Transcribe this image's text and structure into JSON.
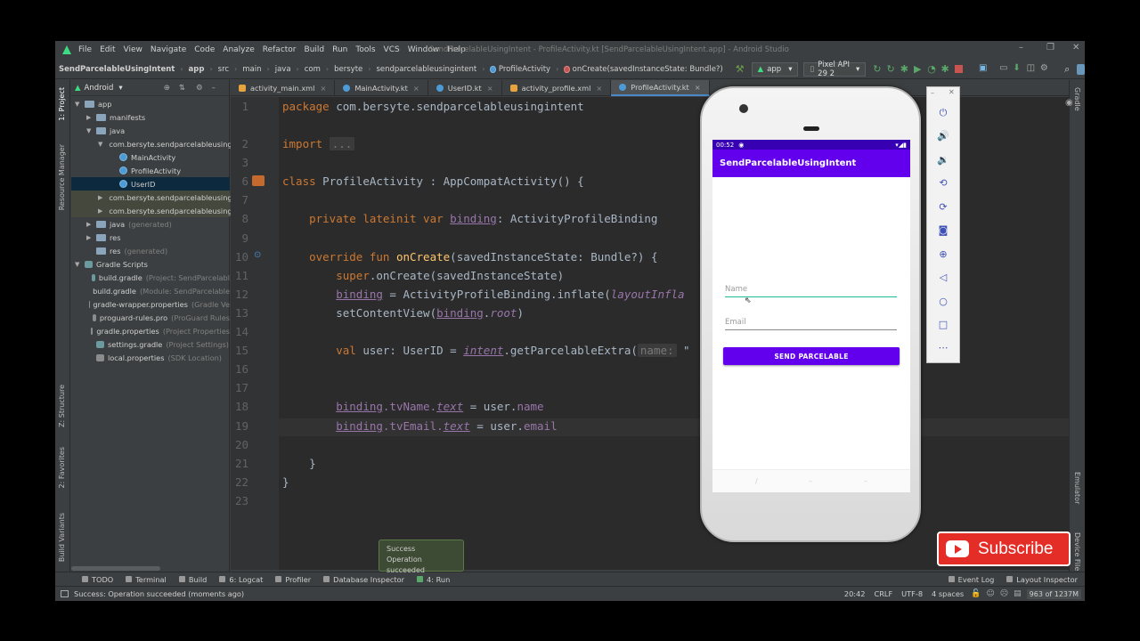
{
  "window": {
    "title": "SendParcelableUsingIntent - ProfileActivity.kt [SendParcelableUsingIntent.app] - Android Studio",
    "menu": [
      "File",
      "Edit",
      "View",
      "Navigate",
      "Code",
      "Analyze",
      "Refactor",
      "Build",
      "Run",
      "Tools",
      "VCS",
      "Window",
      "Help"
    ]
  },
  "breadcrumb": [
    "SendParcelableUsingIntent",
    "app",
    "src",
    "main",
    "java",
    "com",
    "bersyte",
    "sendparcelableusingintent",
    "ProfileActivity",
    "onCreate(savedInstanceState: Bundle?)"
  ],
  "toolbar": {
    "run_config": "app",
    "device": "Pixel API 29 2"
  },
  "project_panel": {
    "view_mode": "Android",
    "items": [
      {
        "label": "app",
        "depth": 0,
        "expanded": true,
        "icon": "folder-icon"
      },
      {
        "label": "manifests",
        "depth": 1,
        "expanded": false,
        "icon": "folder-icon"
      },
      {
        "label": "java",
        "depth": 1,
        "expanded": true,
        "icon": "folder-icon"
      },
      {
        "label": "com.bersyte.sendparcelableusing",
        "depth": 2,
        "expanded": true,
        "icon": "package-icon"
      },
      {
        "label": "MainActivity",
        "depth": 3,
        "icon": "kotlin-icon"
      },
      {
        "label": "ProfileActivity",
        "depth": 3,
        "icon": "kotlin-icon"
      },
      {
        "label": "UserID",
        "depth": 3,
        "icon": "kotlin-icon",
        "selected": true
      },
      {
        "label": "com.bersyte.sendparcelableusing",
        "depth": 2,
        "expanded": false,
        "icon": "package-icon"
      },
      {
        "label": "com.bersyte.sendparcelableusing",
        "depth": 2,
        "expanded": false,
        "icon": "package-icon"
      },
      {
        "label": "java",
        "hint": "(generated)",
        "depth": 1,
        "expanded": false,
        "icon": "folder-icon"
      },
      {
        "label": "res",
        "depth": 1,
        "expanded": false,
        "icon": "folder-icon"
      },
      {
        "label": "res",
        "hint": "(generated)",
        "depth": 1,
        "icon": "folder-icon"
      },
      {
        "label": "Gradle Scripts",
        "depth": 0,
        "expanded": true,
        "icon": "gradle-icon"
      },
      {
        "label": "build.gradle",
        "hint": "(Project: SendParcelabl",
        "depth": 1,
        "icon": "gradle-icon"
      },
      {
        "label": "build.gradle",
        "hint": "(Module: SendParcelable",
        "depth": 1,
        "icon": "gradle-icon"
      },
      {
        "label": "gradle-wrapper.properties",
        "hint": "(Gradle Ve",
        "depth": 1,
        "icon": "properties-icon"
      },
      {
        "label": "proguard-rules.pro",
        "hint": "(ProGuard Rules",
        "depth": 1,
        "icon": "properties-icon"
      },
      {
        "label": "gradle.properties",
        "hint": "(Project Properties",
        "depth": 1,
        "icon": "properties-icon"
      },
      {
        "label": "settings.gradle",
        "hint": "(Project Settings)",
        "depth": 1,
        "icon": "gradle-icon"
      },
      {
        "label": "local.properties",
        "hint": "(SDK Location)",
        "depth": 1,
        "icon": "properties-icon"
      }
    ]
  },
  "left_stripe": [
    "1: Project",
    "Resource Manager",
    "Z: Structure",
    "2: Favorites",
    "Build Variants"
  ],
  "right_stripe": [
    "Gradle",
    "Emulator",
    "Device File Explorer"
  ],
  "editor_tabs": [
    {
      "label": "activity_main.xml",
      "active": false
    },
    {
      "label": "MainActivity.kt",
      "active": false
    },
    {
      "label": "UserID.kt",
      "active": false
    },
    {
      "label": "activity_profile.xml",
      "active": false
    },
    {
      "label": "ProfileActivity.kt",
      "active": true
    }
  ],
  "code_lines": [
    "1",
    "2",
    "3",
    "6",
    "7",
    "8",
    "9",
    "10",
    "11",
    "12",
    "13",
    "14",
    "15",
    "16",
    "17",
    "18",
    "19",
    "20",
    "21",
    "22",
    "23"
  ],
  "code": {
    "l1_kw": "package",
    "l1_rest": " com.bersyte.sendparcelableusingintent",
    "l3_kw": "import",
    "l3_fold": "...",
    "l7_kw": "class",
    "l7_rest": " ProfileActivity : AppCompatActivity() {",
    "l9_kw": "private lateinit var",
    "l9_var": "binding",
    "l9_rest": ": ActivityProfileBinding",
    "l11_kw": "override fun",
    "l11_fn": "onCreate",
    "l11_rest": "(savedInstanceState: Bundle?) {",
    "l12_kw": "super",
    "l12_rest": ".onCreate(savedInstanceState)",
    "l13_var": "binding",
    "l13_rest": " = ActivityProfileBinding.inflate(",
    "l13_it": "layoutInfla",
    "l14_a": "setContentView(",
    "l14_var": "binding",
    "l14_b": ".",
    "l14_prop": "root",
    "l14_c": ")",
    "l16_kw": "val",
    "l16_a": " user: UserID = ",
    "l16_intent": "intent",
    "l16_b": ".getParcelableExtra(",
    "l16_hint": "name:",
    "l16_c": " \"",
    "l19_var": "binding",
    "l19_a": ".tvName.",
    "l19_text": "text",
    "l19_b": " = user.",
    "l19_prop": "name",
    "l20_var": "binding",
    "l20_a": ".tvEmail.",
    "l20_text": "text",
    "l20_b": " = user.",
    "l20_prop": "email",
    "l22": "}",
    "l23": "}"
  },
  "toast": {
    "title": "Success",
    "message": "Operation succeeded"
  },
  "bottom_tabs": [
    "TODO",
    "Terminal",
    "Build",
    "6: Logcat",
    "Profiler",
    "Database Inspector",
    "4: Run"
  ],
  "bottom_right_tabs": [
    "Event Log",
    "Layout Inspector"
  ],
  "status": {
    "message": "Success: Operation succeeded (moments ago)",
    "position": "20:42",
    "line_sep": "CRLF",
    "encoding": "UTF-8",
    "indent": "4 spaces",
    "memory": "963 of 1237M"
  },
  "emulator": {
    "time": "00:52",
    "app_title": "SendParcelableUsingIntent",
    "name_hint": "Name",
    "email_hint": "Email",
    "button": "SEND PARCELABLE"
  },
  "subscribe": {
    "label": "Subscribe"
  },
  "colors": {
    "app_bar": "#6200ee",
    "status_bar": "#3700b3",
    "subscribe": "#e52d27",
    "editor_bg": "#2b2b2b"
  }
}
